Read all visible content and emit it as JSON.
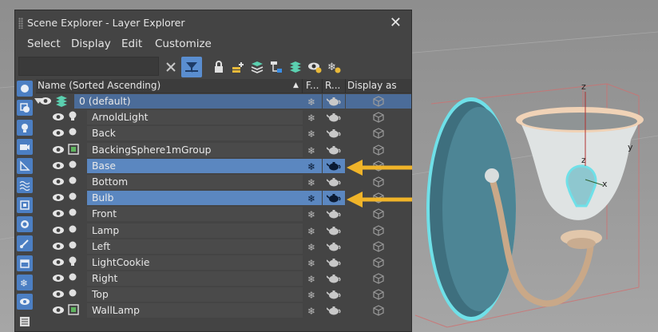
{
  "window": {
    "title": "Scene Explorer - Layer Explorer",
    "close_label": "✕"
  },
  "menu": [
    "Select",
    "Display",
    "Edit",
    "Customize"
  ],
  "search": {
    "value": "",
    "placeholder": ""
  },
  "toolbar_icons": [
    "clear-filter-icon",
    "filter-icon",
    "lock-icon",
    "add-layer-icon",
    "layers-icon",
    "hierarchy-icon",
    "layer-stack-icon",
    "visibility-icon",
    "freeze-icon"
  ],
  "left_icons": [
    "geometry-icon",
    "shapes-icon",
    "light-icon",
    "camera-icon",
    "helper-icon",
    "spacewarp-icon",
    "group-icon",
    "xref-icon",
    "bone-icon",
    "container-icon",
    "frozen-icon",
    "hidden-icon",
    "display-children-icon"
  ],
  "columns": {
    "name": "Name (Sorted Ascending)",
    "sort_indicator": "▲",
    "freeze": "F...",
    "render": "R...",
    "display_as": "Display as"
  },
  "rows": [
    {
      "label": "0 (default)",
      "type": "layer",
      "selected": false,
      "is_layer": true
    },
    {
      "label": "ArnoldLight",
      "type": "light",
      "selected": false
    },
    {
      "label": "Back",
      "type": "geometry",
      "selected": false
    },
    {
      "label": "BackingSphere1mGroup",
      "type": "group",
      "selected": false
    },
    {
      "label": "Base",
      "type": "geometry",
      "selected": true
    },
    {
      "label": "Bottom",
      "type": "geometry",
      "selected": false
    },
    {
      "label": "Bulb",
      "type": "geometry",
      "selected": true
    },
    {
      "label": "Front",
      "type": "geometry",
      "selected": false
    },
    {
      "label": "Lamp",
      "type": "geometry",
      "selected": false
    },
    {
      "label": "Left",
      "type": "geometry",
      "selected": false
    },
    {
      "label": "LightCookie",
      "type": "light",
      "selected": false
    },
    {
      "label": "Right",
      "type": "geometry",
      "selected": false
    },
    {
      "label": "Top",
      "type": "geometry",
      "selected": false
    },
    {
      "label": "WallLamp",
      "type": "group",
      "selected": false
    }
  ],
  "viewport_axes": [
    "z",
    "z",
    "y",
    "x"
  ],
  "colors": {
    "accent": "#5b87c0",
    "selection_arrow": "#f0b429",
    "panel_bg": "#444444",
    "viewport_bg": "#9a9a9a",
    "object_outline": "#6fe0e8"
  }
}
